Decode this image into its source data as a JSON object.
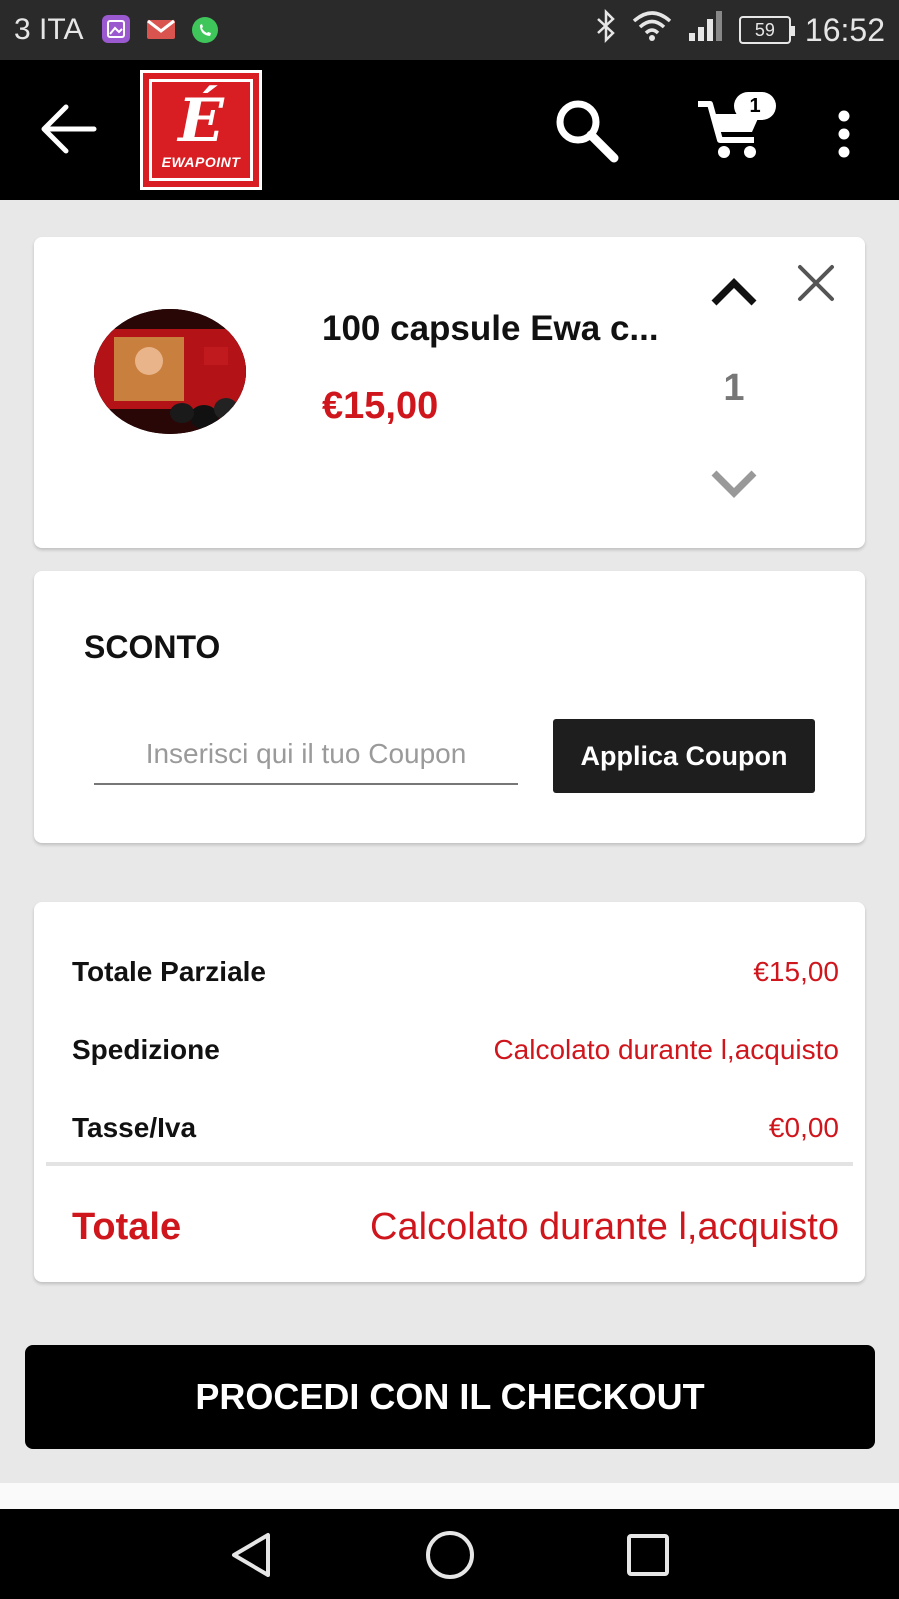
{
  "status_bar": {
    "carrier": "3 ITA",
    "battery": "59",
    "time": "16:52",
    "apps": [
      {
        "name": "gallery-notification-icon",
        "color": "#9b59d0"
      },
      {
        "name": "gmail-notification-icon",
        "color": "#d9534f"
      },
      {
        "name": "whatsapp-notification-icon",
        "color": "#3ec65b"
      }
    ]
  },
  "app_bar": {
    "logo_letter": "É",
    "logo_text": "EWAPOINT",
    "cart_count": "1",
    "icons": [
      "back-arrow-icon",
      "search-icon",
      "cart-icon",
      "more-vert-icon"
    ]
  },
  "cart_item": {
    "name": "100 capsule Ewa c...",
    "price": "€15,00",
    "quantity": "1"
  },
  "coupon": {
    "title": "SCONTO",
    "placeholder": "Inserisci qui il tuo Coupon",
    "button_label": "Applica Coupon"
  },
  "summary": {
    "subtotal_label": "Totale Parziale",
    "subtotal_value": "€15,00",
    "shipping_label": "Spedizione",
    "shipping_value": "Calcolato durante l,acquisto",
    "tax_label": "Tasse/Iva",
    "tax_value": "€0,00",
    "total_label": "Totale",
    "total_value": "Calcolato durante l,acquisto"
  },
  "checkout_label": "PROCEDI CON IL CHECKOUT",
  "colors": {
    "accent_red": "#d0161d",
    "logo_red": "#d81d23",
    "app_bar": "#000000",
    "background": "#e8e8e8"
  }
}
